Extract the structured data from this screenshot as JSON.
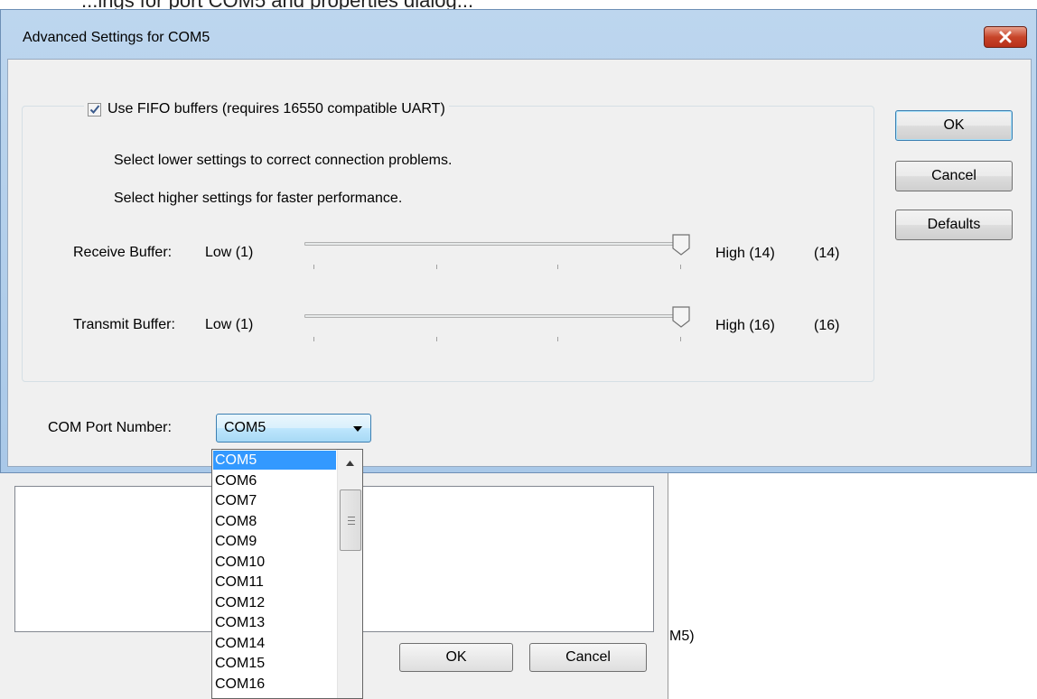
{
  "background": {
    "top_text": "...ings for port COM5 and properties dialog...",
    "ok_label": "OK",
    "cancel_label": "Cancel",
    "fragment": "M5)"
  },
  "dialog": {
    "title": "Advanced Settings for COM5",
    "close_icon": "close-x-icon",
    "fifo": {
      "checked": true,
      "label": "Use FIFO buffers (requires 16550 compatible UART)"
    },
    "info_lines": [
      "Select lower settings to correct connection problems.",
      "Select higher settings for faster performance."
    ],
    "receive": {
      "label": "Receive Buffer:",
      "low": "Low (1)",
      "high": "High (14)",
      "value": "(14)",
      "level": 14,
      "max": 14
    },
    "transmit": {
      "label": "Transmit Buffer:",
      "low": "Low (1)",
      "high": "High (16)",
      "value": "(16)",
      "level": 16,
      "max": 16
    },
    "buttons": {
      "ok": "OK",
      "cancel": "Cancel",
      "defaults": "Defaults"
    },
    "com_port": {
      "label": "COM Port Number:",
      "selected": "COM5",
      "options": [
        "COM5",
        "COM6",
        "COM7",
        "COM8",
        "COM9",
        "COM10",
        "COM11",
        "COM12",
        "COM13",
        "COM14",
        "COM15",
        "COM16"
      ]
    }
  },
  "colors": {
    "selection": "#3399ff",
    "close_button": "#c7452a",
    "title_bar": "#bdd6ee"
  }
}
